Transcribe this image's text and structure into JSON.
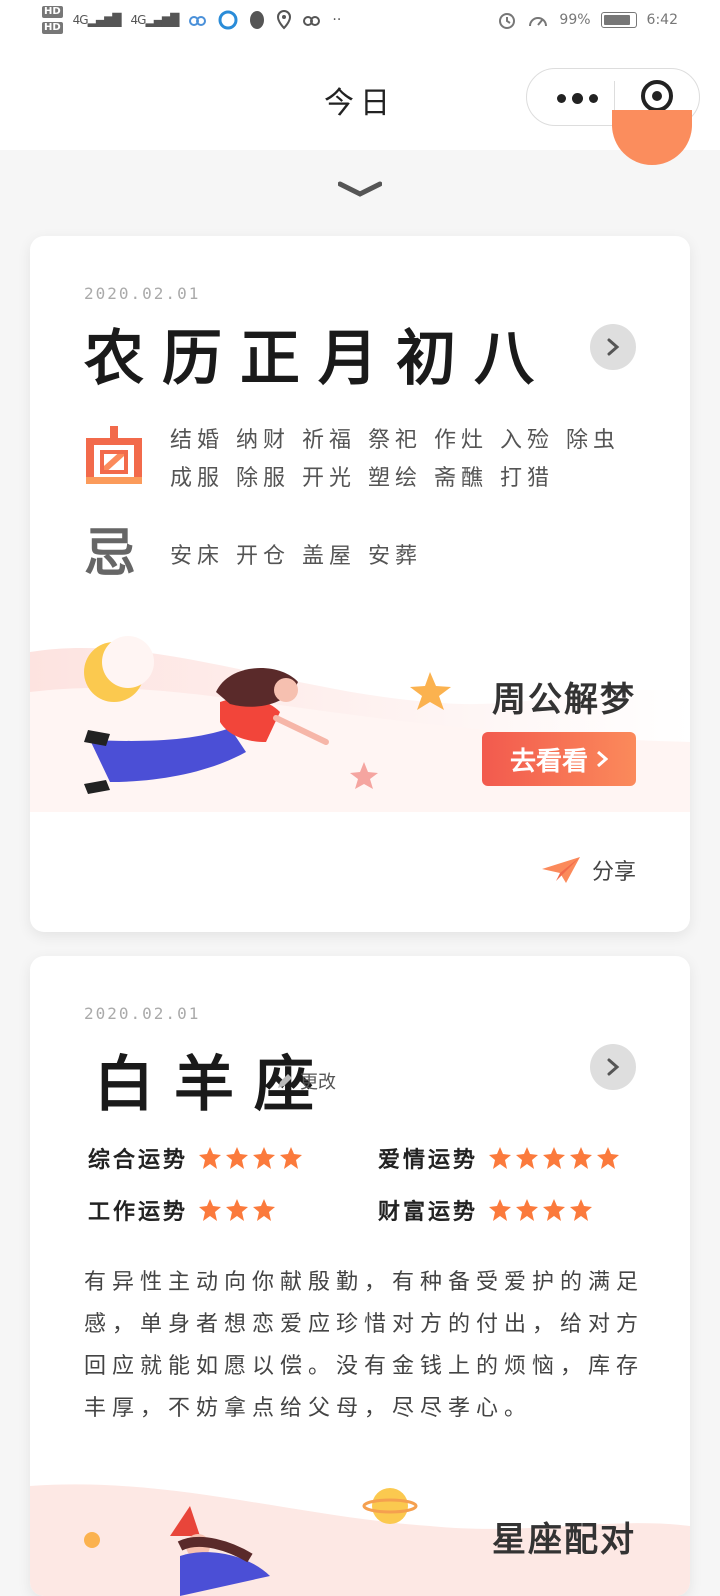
{
  "status_bar": {
    "hd1": "HD",
    "hd2": "HD",
    "sig1": "4G",
    "sig2": "4G",
    "more": "··",
    "battery_pct": "99%",
    "time": "6:42"
  },
  "nav": {
    "title": "今日"
  },
  "almanac": {
    "date": "2020.02.01",
    "lunar_date": "农历正月初八",
    "yi_label": "宜",
    "ji_label": "忌",
    "yi_items": "结婚 纳财 祈福 祭祀 作灶 入殓 除虫 成服 除服 开光 塑绘 斋醮 打猎",
    "ji_items": "安床 开仓 盖屋 安葬",
    "banner_title": "周公解梦",
    "banner_button": "去看看",
    "share_label": "分享"
  },
  "horoscope": {
    "date": "2020.02.01",
    "sign": "白羊座",
    "edit_label": "更改",
    "fortunes": [
      {
        "label": "综合运势",
        "stars": 4
      },
      {
        "label": "爱情运势",
        "stars": 5
      },
      {
        "label": "工作运势",
        "stars": 3
      },
      {
        "label": "财富运势",
        "stars": 4
      }
    ],
    "description": "有异性主动向你献殷勤，有种备受爱护的满足感，单身者想恋爱应珍惜对方的付出，给对方回应就能如愿以偿。没有金钱上的烦恼，库存丰厚，不妨拿点给父母，尽尽孝心。",
    "banner_title": "星座配对"
  },
  "colors": {
    "accent": "#f26a4b",
    "star": "#fb7a3c"
  }
}
